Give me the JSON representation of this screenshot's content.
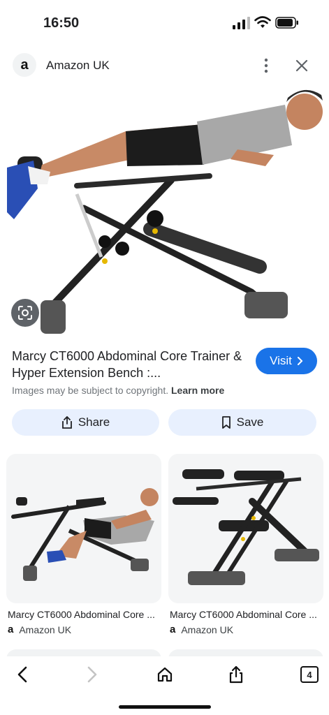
{
  "status": {
    "time": "16:50"
  },
  "source": {
    "logo_letter": "a",
    "name": "Amazon UK"
  },
  "result": {
    "title": "Marcy CT6000 Abdominal Core Trainer & Hyper Extension Bench :...",
    "visit_label": "Visit",
    "copyright_text": "Images may be subject to copyright.",
    "learn_more": "Learn more"
  },
  "actions": {
    "share_label": "Share",
    "save_label": "Save"
  },
  "related": [
    {
      "title": "Marcy CT6000 Abdominal Core ...",
      "source": "Amazon UK",
      "logo_letter": "a"
    },
    {
      "title": "Marcy CT6000 Abdominal Core ...",
      "source": "Amazon UK",
      "logo_letter": "a"
    }
  ],
  "toolbar": {
    "tab_count": "4"
  },
  "colors": {
    "accent": "#1a73e8",
    "pill_bg": "#e8f0fe"
  }
}
